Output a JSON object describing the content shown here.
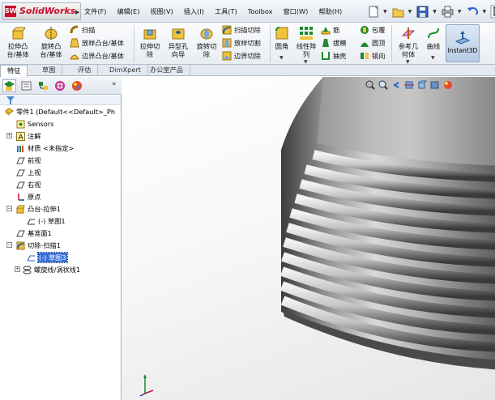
{
  "app": {
    "name": "SolidWorks"
  },
  "menu": [
    "文件(F)",
    "编辑(E)",
    "视图(V)",
    "插入(I)",
    "工具(T)",
    "Toolbox",
    "窗口(W)",
    "帮助(H)"
  ],
  "quick_tools": [
    "new-icon",
    "open-icon",
    "save-icon",
    "print-icon",
    "undo-icon",
    "select-icon"
  ],
  "ribbon": {
    "extrude_boss": "拉伸凸\n台/基体",
    "revolve_boss": "旋转凸\n台/基体",
    "sweep": "扫描",
    "loft_boss": "放样凸台/基体",
    "boundary_boss": "边界凸台/基体",
    "extrude_cut": "拉伸切\n除",
    "hole_wizard": "异型孔\n向导",
    "revolve_cut": "旋转切\n除",
    "swept_cut": "扫描切除",
    "lofted_cut": "放样切割",
    "boundary_cut": "边界切除",
    "fillet": "圆角",
    "linear_pattern": "线性阵\n列",
    "rib": "筋",
    "draft": "拔模",
    "shell": "抽壳",
    "wrap": "包覆",
    "dome": "圆顶",
    "mirror": "镜向",
    "ref_geometry": "参考几\n何体",
    "curves": "曲线",
    "instant3d": "Instant3D"
  },
  "tabs": [
    "特征",
    "草图",
    "评估",
    "DimXpert",
    "办公室产品"
  ],
  "tree": {
    "part": "零件1  (Default<<Default>_Ph",
    "items": [
      {
        "label": "Sensors",
        "icon": "sensors-icon"
      },
      {
        "label": "注解",
        "icon": "annotations-icon"
      },
      {
        "label": "材质 <未指定>",
        "icon": "material-icon"
      },
      {
        "label": "前视",
        "icon": "plane-icon"
      },
      {
        "label": "上视",
        "icon": "plane-icon"
      },
      {
        "label": "右视",
        "icon": "plane-icon"
      },
      {
        "label": "原点",
        "icon": "origin-icon"
      },
      {
        "label": "凸台-拉伸1",
        "icon": "extrude-icon"
      },
      {
        "label": "(-) 草图1",
        "icon": "sketch-icon"
      },
      {
        "label": "基准面1",
        "icon": "plane-icon"
      },
      {
        "label": "切除-扫描1",
        "icon": "swept-cut-icon"
      },
      {
        "label": "(-) 草图3",
        "icon": "sketch-icon"
      },
      {
        "label": "螺旋线/涡状线1",
        "icon": "helix-icon"
      }
    ]
  },
  "colors": {
    "brand": "#c8102e",
    "selection": "#3a6fd8",
    "ribbon_bg": "#e8edf3"
  }
}
